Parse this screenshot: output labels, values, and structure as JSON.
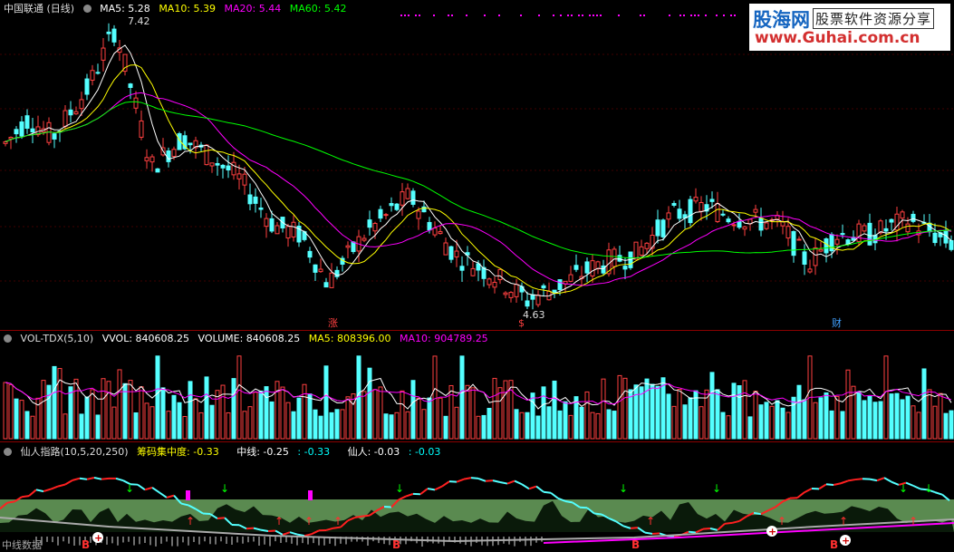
{
  "main": {
    "title": "中国联通 (日线)",
    "indicators": [
      {
        "label": "MA5: 5.28",
        "color": "#ffffff"
      },
      {
        "label": "MA10: 5.39",
        "color": "#ffff00"
      },
      {
        "label": "MA20: 5.44",
        "color": "#ff00ff"
      },
      {
        "label": "MA60: 5.42",
        "color": "#00ff00"
      }
    ],
    "high_label": "7.42",
    "low_label": "4.63",
    "markers": [
      "涨",
      "$",
      "财"
    ]
  },
  "volume": {
    "title": "VOL-TDX(5,10)",
    "values": [
      {
        "label": "VVOL: 840608.25",
        "color": "#ffffff"
      },
      {
        "label": "VOLUME: 840608.25",
        "color": "#ffffff"
      },
      {
        "label": "MA5: 808396.00",
        "color": "#ffff00"
      },
      {
        "label": "MA10: 904789.25",
        "color": "#ff00ff"
      }
    ]
  },
  "indicator": {
    "title": "仙人指路(10,5,20,250)",
    "values": [
      {
        "label": "筹码集中度: -0.33",
        "color": "#ffff00"
      },
      {
        "label": "中线: -0.25",
        "color": "#ffffff"
      },
      {
        "label": ": -0.33",
        "color": "#00ffff"
      },
      {
        "label": "仙人: -0.03",
        "color": "#ffffff"
      },
      {
        "label": ": -0.03",
        "color": "#00ffff"
      }
    ],
    "bottom_text": "中线数据"
  },
  "logo": {
    "name": "股海网",
    "slogan": "股票软件资源分享",
    "url": "www.Guhai.com.cn"
  }
}
